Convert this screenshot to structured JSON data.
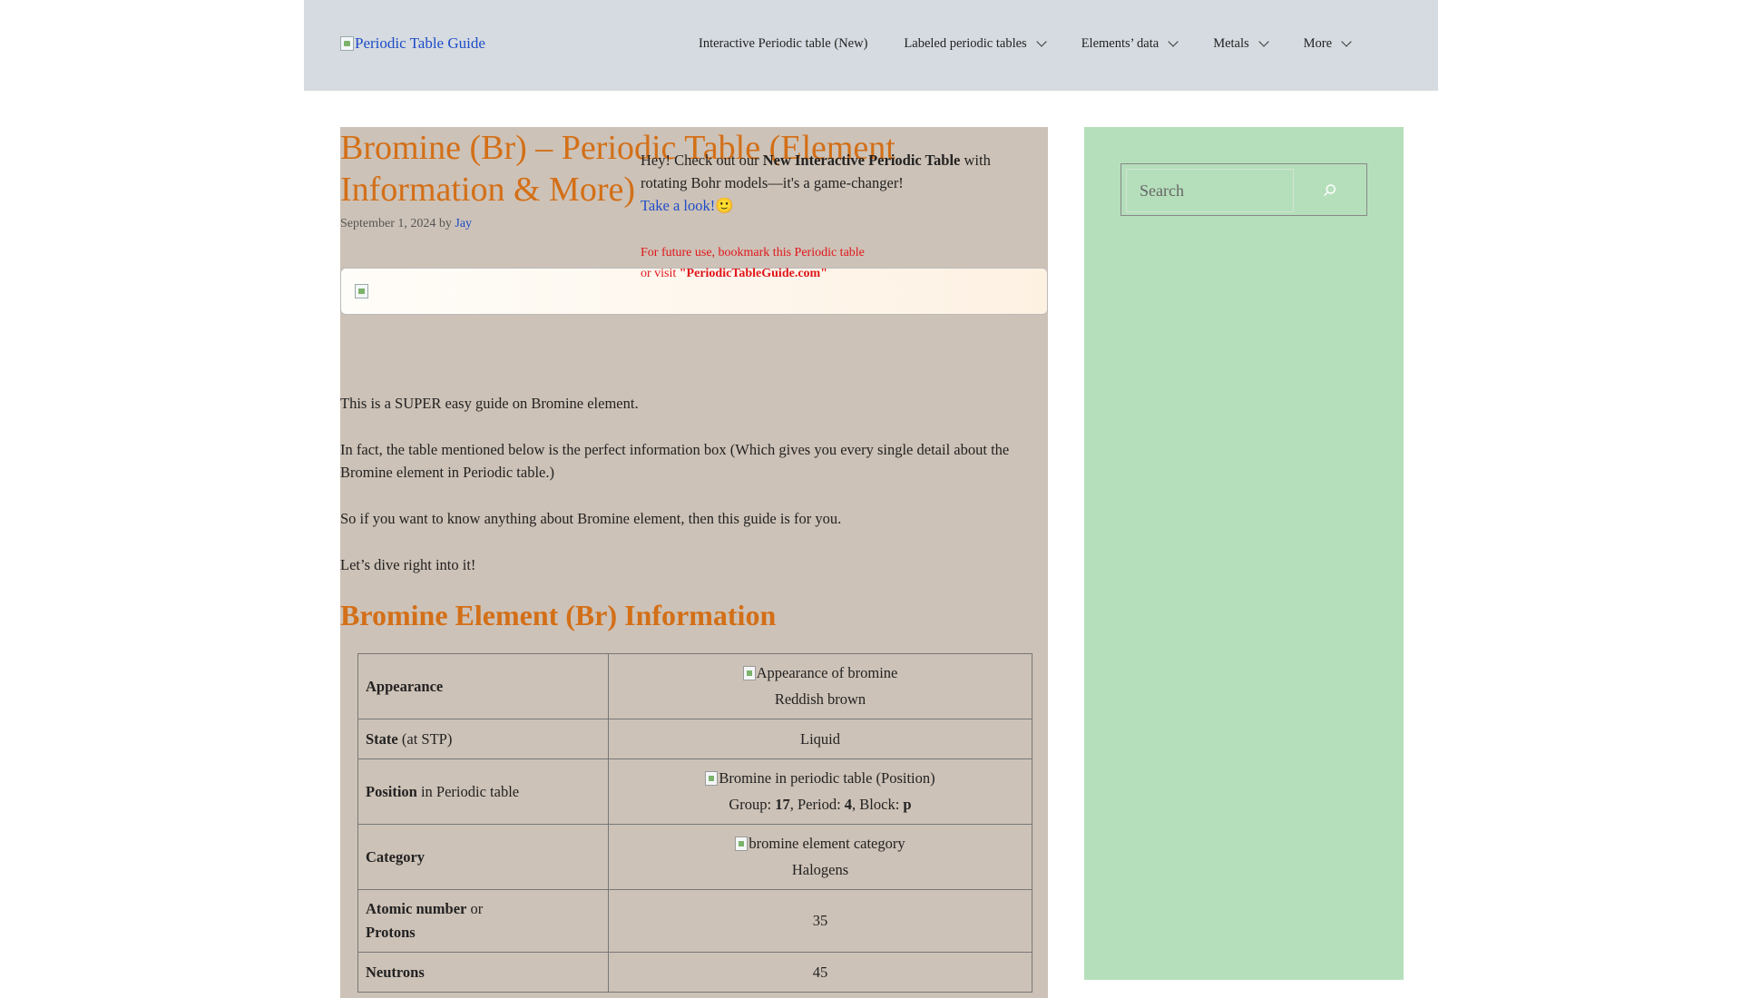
{
  "header": {
    "logo_text": "Periodic Table Guide",
    "nav": [
      {
        "label": "Interactive Periodic table (New)",
        "dropdown": false
      },
      {
        "label": "Labeled periodic tables",
        "dropdown": true
      },
      {
        "label": "Elements’ data",
        "dropdown": true
      },
      {
        "label": "Metals",
        "dropdown": true
      },
      {
        "label": "More",
        "dropdown": true
      }
    ]
  },
  "article": {
    "title": "Bromine (Br) – Periodic Table (Element Information & More)",
    "date": "September 1, 2024",
    "by": "by",
    "author": "Jay",
    "promo": {
      "prefix": "Hey! Check out our ",
      "bold": "New Interactive Periodic Table",
      "suffix": " with rotating Bohr models—it's a game-changer!",
      "link": "Take a look!",
      "emoji": "🙂"
    },
    "bookmark": {
      "line1": "For future use, bookmark this Periodic table",
      "prefix2": "or visit ",
      "site": "\"PeriodicTableGuide.com\""
    },
    "paragraphs": [
      "This is a SUPER easy guide on Bromine element.",
      "In fact, the table mentioned below is the perfect information box (Which gives you every single detail about the Bromine element in Periodic table.)",
      "So if you want to know anything about Bromine element, then this guide is for you.",
      "Let’s dive right into it!"
    ],
    "section_heading": "Bromine Element (Br) Information",
    "table": {
      "appearance": {
        "key": "Appearance",
        "img_alt": "Appearance of bromine",
        "value": "Reddish brown"
      },
      "state": {
        "key": "State",
        "key_suffix": " (at STP)",
        "value": "Liquid"
      },
      "position": {
        "key": "Position",
        "key_suffix": " in Periodic table",
        "img_alt": "Bromine in periodic table (Position)",
        "group_label": "Group: ",
        "group": "17",
        "period_label": ", Period: ",
        "period": "4",
        "block_label": ", Block: ",
        "block": "p"
      },
      "category": {
        "key": "Category",
        "img_alt": "bromine element category",
        "value": "Halogens"
      },
      "atomic": {
        "key1": "Atomic number",
        "or": " or",
        "key2": "Protons",
        "value": "35"
      },
      "neutrons": {
        "key": "Neutrons",
        "value": "45"
      }
    }
  },
  "sidebar": {
    "search_placeholder": "Search",
    "search_icon": "search-icon"
  },
  "colors": {
    "header_bg": "#d5dbe0",
    "article_bg": "#cdc2b7",
    "sidebar_bg": "#b5dfbb",
    "heading_orange": "#d36f17",
    "link_blue": "#1e4bc8",
    "alert_red": "#e0161b"
  }
}
